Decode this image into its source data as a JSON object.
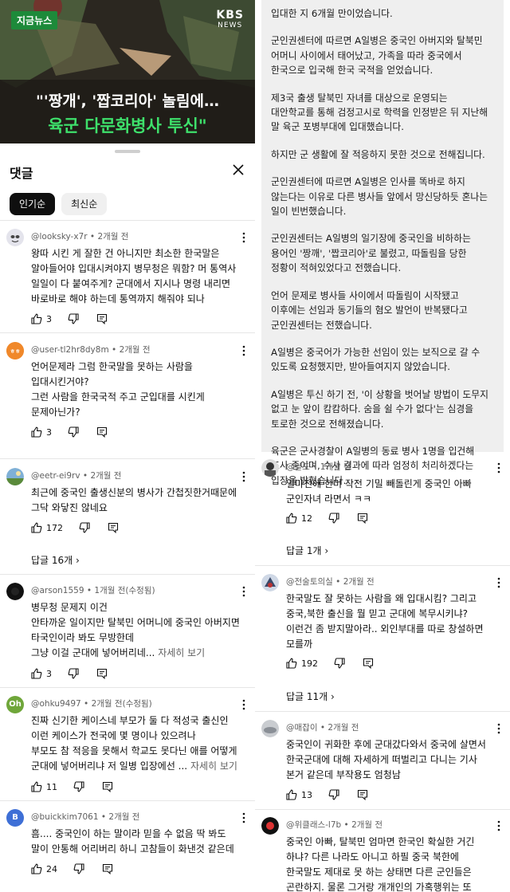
{
  "news": {
    "tag": "지금뉴스",
    "logo_main": "KBS",
    "logo_sub": "NEWS",
    "headline_1": "\"'짱개', '짭코리아' 놀림에…",
    "headline_2": "육군 다문화병사 투신\""
  },
  "comments_panel": {
    "title": "댓글",
    "sort_popular": "인기순",
    "sort_latest": "최신순"
  },
  "left_comments": [
    {
      "author": "@looksky-x7r",
      "time": "2개월 전",
      "lines": [
        "왕따 시킨 게 잘한 건 아니지만 최소한 한국말은",
        "알아들어야 입대시켜야지 병무청은 뭐함? 머 통역사",
        "일일이 다 붙여주게?  군대에서 지시나 명령 내리면",
        "바로바로 해야 하는데 통역까지 해줘야 되나"
      ],
      "likes": "3"
    },
    {
      "author": "@user-tl2hr8dy8m",
      "time": "2개월 전",
      "lines": [
        "언어문제라 그럼 한국말을 못하는 사람을",
        "입대시킨거야?",
        "그런 사람을 한국국적 주고 군입대를 시킨게",
        "문제아닌가?"
      ],
      "likes": "3"
    },
    {
      "author": "@eetr-ei9rv",
      "time": "2개월 전",
      "lines": [
        "최근에 중국인 출생신분의 병사가 간첩짓한거때문에",
        "그닥 와닿진 않네요"
      ],
      "likes": "172",
      "replies": "답글 16개"
    },
    {
      "author": "@arson1559",
      "time": "1개월 전(수정됨)",
      "lines": [
        "병무청 문제지 이건",
        "안타까운 일이지만 탈북민 어머니에 중국인 아버지면",
        "타국인이라 봐도 무방한데",
        "그냥 이걸 군대에 넣어버리네..."
      ],
      "more": "자세히 보기",
      "likes": "3"
    },
    {
      "author": "@ohku9497",
      "time": "2개월 전(수정됨)",
      "lines": [
        "진짜 신기한 케이스네  부모가 둘 다 적성국 출신인",
        "이런 케이스가 전국에 몇 명이나 있으려나",
        "부모도 참 적응을 못해서 학교도 못다닌 애를 어떻게",
        "군대에 넣어버리냐 저 일병 입장에선 ..."
      ],
      "more": "자세히 보기",
      "likes": "11",
      "avatar_letter": "Oh"
    },
    {
      "author": "@buickkim7061",
      "time": "2개월 전",
      "lines": [
        "흠.... 중국인이 하는 말이라 믿을 수 없음  딱 봐도",
        "말이 안통해 어리버리 하니 고참들이 화낸것 같은데"
      ],
      "likes": "24",
      "avatar_letter": "B"
    }
  ],
  "article_paragraphs": [
    [
      "입대한 지 6개월 만이었습니다."
    ],
    [
      "군인권센터에 따르면 A일병은 중국인 아버지와 탈북민",
      "어머니 사이에서 태어났고, 가족을 따라 중국에서",
      "한국으로 입국해 한국 국적을 얻었습니다."
    ],
    [
      "제3국 출생 탈북민 자녀를 대상으로 운영되는",
      "대안학교를 통해 검정고시로 학력을 인정받은 뒤 지난해",
      "말 육군 포병부대에 입대했습니다."
    ],
    [
      "하지만 군 생활에 잘 적응하지 못한 것으로 전해집니다."
    ],
    [
      "군인권센터에 따르면 A일병은 인사를 똑바로 하지",
      "않는다는 이유로 다른 병사들 앞에서 망신당하듯 혼나는",
      "일이 빈번했습니다."
    ],
    [
      "군인권센터는 A일병의 일기장에 중국인을 비하하는",
      "용어인 '짱깨', '짭코리아'로 불렸고, 따돌림을 당한",
      "정황이 적혀있었다고 전했습니다."
    ],
    [
      "언어 문제로 병사들 사이에서 따돌림이 시작됐고",
      "이후에는 선임과 동기들의 혐오 발언이 반복됐다고",
      "군인권센터는 전했습니다."
    ],
    [
      "A일병은 중국어가 가능한 선임이 있는 보직으로 갈 수",
      "있도록 요청했지만, 받아들여지지 않았습니다."
    ],
    [
      "A일병은 투신 하기 전, '이 상황을 벗어날 방법이 도무지",
      "없고 눈 앞이 캄캄하다. 숨을 쉴 수가 없다'는 심경을",
      "토로한 것으로 전해졌습니다."
    ],
    [
      "육군은 군사경찰이 A일병의 동료 병사 1명을 입건해",
      "조사 중이며, 수사 결과에 따라 엄정히 처리하겠다는",
      "입장을 밝혔습니다."
    ]
  ],
  "right_comments": [
    {
      "author": "@날도",
      "time": "1개월 전",
      "lines": [
        "얼마전에 한미 작전 기밀 빼돌린게 중국인 아빠",
        "군인자녀 라면서 ㅋㅋ"
      ],
      "likes": "12",
      "replies": "답글 1개"
    },
    {
      "author": "@전술토의실",
      "time": "2개월 전",
      "lines": [
        "한국말도 잘 못하는 사람을 왜 입대시킴? 그리고",
        "중국,북한 출신을 뭘 믿고 군대에 복무시키냐?",
        "이런건 좀 받지말아라.. 외인부대를 따로 창설하면",
        "모를까"
      ],
      "likes": "192",
      "replies": "답글 11개"
    },
    {
      "author": "@매잡이",
      "time": "2개월 전",
      "lines": [
        "중국인이 귀화한 후에 군대갔다와서  중국에 살면서",
        "한국군대에 대해 자세하게 떠벌리고 다니는 기사",
        "본거 같은데 부작용도 엄청남"
      ],
      "likes": "13"
    },
    {
      "author": "@위클래스-l7b",
      "time": "2개월 전",
      "lines": [
        "중국인 아빠, 탈북민 엄마면 한국인 확실한 거긴",
        "하냐? 다른 나라도 아니고 하필 중국 북한에",
        "한국말도 제대로 못 하는 상태면 다른 군인들은",
        "곤란하지. 물론 그거랑 개개인의 가혹행위는 또"
      ]
    }
  ],
  "colors": {
    "news_tag_green": "#1d8a3a",
    "headline_green": "#3ee06b",
    "article_bg": "#efefef",
    "chip_active_bg": "#0f0f0f"
  }
}
